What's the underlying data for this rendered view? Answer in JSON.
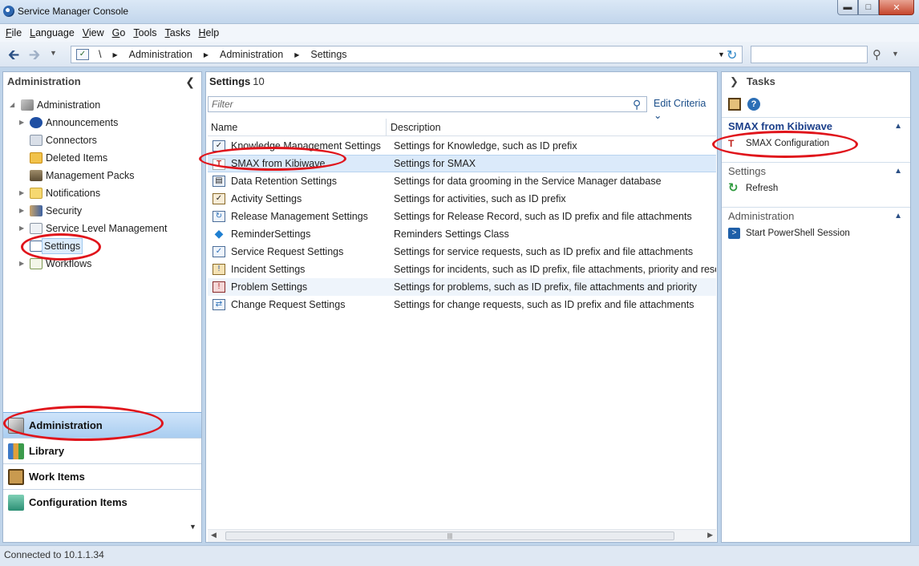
{
  "window": {
    "title": "Service Manager Console"
  },
  "menu": [
    {
      "underline": "F",
      "rest": "ile"
    },
    {
      "underline": "L",
      "rest": "anguage"
    },
    {
      "underline": "V",
      "rest": "iew"
    },
    {
      "underline": "G",
      "rest": "o"
    },
    {
      "underline": "T",
      "rest": "ools"
    },
    {
      "underline": "T",
      "rest": "asks"
    },
    {
      "underline": "H",
      "rest": "elp"
    }
  ],
  "navigation": {
    "root": "\\",
    "crumbs": [
      "Administration",
      "Administration",
      "Settings"
    ],
    "search_value": ""
  },
  "left_pane": {
    "title": "Administration",
    "tree": [
      {
        "label": "Administration",
        "icon": "admin-icon"
      },
      {
        "label": "Announcements",
        "icon": "info-icon"
      },
      {
        "label": "Connectors",
        "icon": "connector-icon"
      },
      {
        "label": "Deleted Items",
        "icon": "delete-icon"
      },
      {
        "label": "Management Packs",
        "icon": "pack-icon"
      },
      {
        "label": "Notifications",
        "icon": "envelope-icon"
      },
      {
        "label": "Security",
        "icon": "security-icon"
      },
      {
        "label": "Service Level Management",
        "icon": "slm-icon"
      },
      {
        "label": "Settings",
        "icon": "settings-icon"
      },
      {
        "label": "Workflows",
        "icon": "workflow-icon"
      }
    ],
    "workspaces": [
      "Administration",
      "Library",
      "Work Items",
      "Configuration Items"
    ]
  },
  "center_pane": {
    "title": "Settings",
    "count": "10",
    "filter_placeholder": "Filter",
    "edit_criteria": "Edit Criteria",
    "columns": [
      "Name",
      "Description"
    ],
    "rows": [
      {
        "name": "Knowledge Management Settings",
        "description": "Settings for Knowledge, such as ID prefix"
      },
      {
        "name": "SMAX from Kibiwave",
        "description": "Settings for SMAX"
      },
      {
        "name": "Data Retention Settings",
        "description": "Settings for data grooming in the Service Manager database"
      },
      {
        "name": "Activity Settings",
        "description": "Settings for activities, such as ID prefix"
      },
      {
        "name": "Release Management Settings",
        "description": "Settings for Release Record, such as ID prefix and file attachments"
      },
      {
        "name": "ReminderSettings",
        "description": "Reminders Settings Class"
      },
      {
        "name": "Service Request Settings",
        "description": "Settings for service requests, such as ID prefix and file attachments"
      },
      {
        "name": "Incident Settings",
        "description": "Settings for incidents, such as ID prefix, file attachments, priority and resoluti"
      },
      {
        "name": "Problem Settings",
        "description": "Settings for problems, such as ID prefix, file attachments and priority"
      },
      {
        "name": "Change Request Settings",
        "description": "Settings for change requests, such as ID prefix and file attachments"
      }
    ]
  },
  "right_pane": {
    "title": "Tasks",
    "sections": [
      {
        "title": "SMAX from Kibiwave",
        "tasks": [
          "SMAX Configuration"
        ]
      },
      {
        "title": "Settings",
        "tasks": [
          "Refresh"
        ]
      },
      {
        "title": "Administration",
        "tasks": [
          "Start PowerShell Session"
        ]
      }
    ]
  },
  "status": {
    "text": "Connected to 10.1.1.34"
  },
  "colors": {
    "accent": "#1b3f8a",
    "annotation": "#e0141b",
    "selection": "#dbeafa"
  }
}
